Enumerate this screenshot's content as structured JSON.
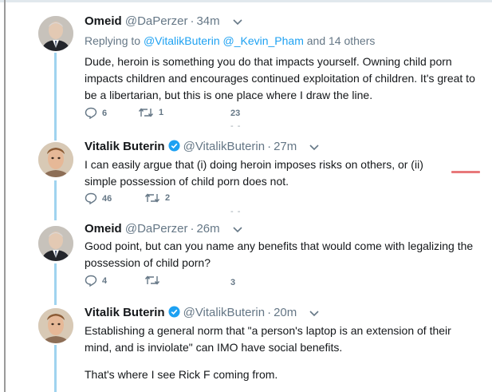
{
  "tweets": [
    {
      "name": "Omeid",
      "handle": "@DaPerzer",
      "time": "34m",
      "verified": false,
      "reply_prefix": "Replying to ",
      "reply_mentions": "@VitalikButerin @_Kevin_Pham",
      "reply_suffix": " and 14 others",
      "text": "Dude, heroin is something you do that impacts yourself. Owning child porn impacts children and encourages continued exploitation of children. It's great to be a libertarian, but this is one place where I draw the line.",
      "replies": "6",
      "retweets": "1",
      "likes": "23"
    },
    {
      "name": "Vitalik Buterin",
      "handle": "@VitalikButerin",
      "time": "27m",
      "verified": true,
      "text": "I can easily argue that (i) doing heroin imposes risks on others, or (ii) simple possession of child porn does not.",
      "replies": "46",
      "retweets": "2",
      "likes": ""
    },
    {
      "name": "Omeid",
      "handle": "@DaPerzer",
      "time": "26m",
      "verified": false,
      "text": "Good point, but can you name any benefits that would come with legalizing the possession of child porn?",
      "replies": "4",
      "retweets": "",
      "likes": "3"
    },
    {
      "name": "Vitalik Buterin",
      "handle": "@VitalikButerin",
      "time": "20m",
      "verified": true,
      "text": "Establishing a general norm that \"a person's laptop is an extension of their mind, and is inviolate\" can IMO have social benefits.",
      "text2": "That's where I see Rick F coming from."
    }
  ],
  "icons": [
    "reply-icon",
    "retweet-icon",
    "like-icon",
    "verified-icon",
    "chevron-down-icon"
  ],
  "colors": {
    "link": "#1da1f2",
    "secondary": "#657786",
    "thread": "#9fd3ef",
    "verified": "#1da1f2"
  }
}
